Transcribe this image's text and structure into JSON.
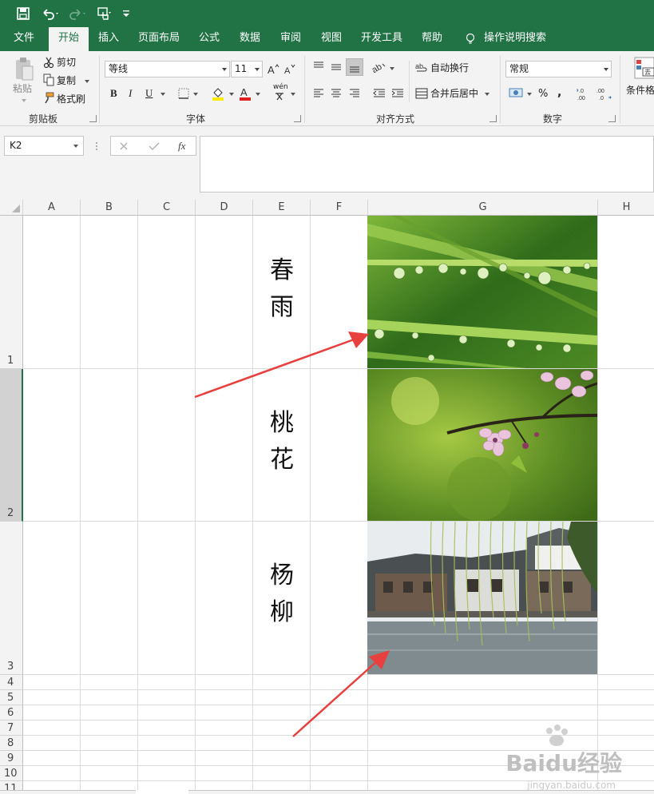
{
  "window": {
    "accent": "#217346",
    "qat": [
      "save-icon",
      "undo-icon",
      "redo-icon",
      "touch-mode-icon",
      "customize-icon"
    ]
  },
  "tabs": [
    "文件",
    "开始",
    "插入",
    "页面布局",
    "公式",
    "数据",
    "审阅",
    "视图",
    "开发工具",
    "帮助"
  ],
  "active_tab": "开始",
  "tell_me": "操作说明搜索",
  "ribbon": {
    "clipboard": {
      "label": "剪贴板",
      "paste": "粘贴",
      "cut": "剪切",
      "copy": "复制",
      "format_painter": "格式刷"
    },
    "font": {
      "label": "字体",
      "font_name": "等线",
      "font_size": "11",
      "bold": "B",
      "italic": "I",
      "underline": "U",
      "phonetic": "wén"
    },
    "alignment": {
      "label": "对齐方式",
      "wrap_text": "自动换行",
      "merge_center": "合并后居中"
    },
    "number": {
      "label": "数字",
      "format": "常规",
      "percent": "%",
      "comma": ","
    },
    "styles": {
      "conditional": "条件格"
    }
  },
  "formula_bar": {
    "name_box": "K2",
    "fx": "fx",
    "formula": ""
  },
  "sheet": {
    "columns": [
      "A",
      "B",
      "C",
      "D",
      "E",
      "F",
      "G",
      "H"
    ],
    "rows": [
      "1",
      "2",
      "3",
      "4",
      "5",
      "6",
      "7",
      "8",
      "9",
      "10",
      "11"
    ],
    "poems": [
      {
        "row": "1",
        "line1": "春",
        "line2": "雨"
      },
      {
        "row": "2",
        "line1": "桃",
        "line2": "花"
      },
      {
        "row": "3",
        "line1": "杨",
        "line2": "柳"
      }
    ],
    "images": [
      "grass-raindrops-image",
      "peach-blossom-image",
      "willow-river-image"
    ]
  },
  "watermark": {
    "main": "Baidu经验",
    "sub": "jingyan.baidu.com"
  },
  "colors": {
    "arrow": "#e8403f",
    "header": "#f3f3f3",
    "gridline": "#dadada"
  }
}
